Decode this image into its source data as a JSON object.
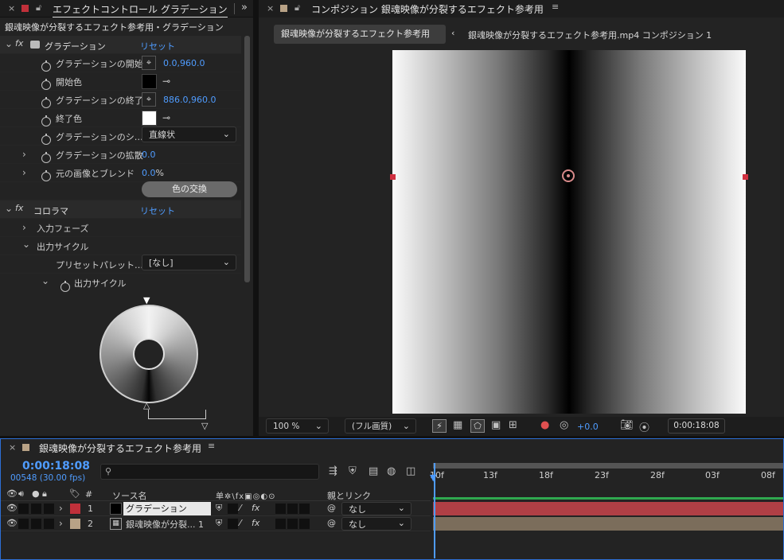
{
  "effects_panel": {
    "tab_title": "エフェクトコントロール グラデーション",
    "layer_path": "銀魂映像が分裂するエフェクト参考用・グラデーション",
    "ramp": {
      "name": "グラデーション",
      "reset": "リセット",
      "start_label": "グラデーションの開始",
      "start_value": "0.0,960.0",
      "start_color_label": "開始色",
      "end_label": "グラデーションの終了",
      "end_value": "886.0,960.0",
      "end_color_label": "終了色",
      "shape_label": "グラデーションのシ…",
      "shape_value": "直線状",
      "scatter_label": "グラデーションの拡散",
      "scatter_value": "0.0",
      "blend_label": "元の画像とブレンド",
      "blend_value": "0.0",
      "blend_unit": "%",
      "swap_button": "色の交換"
    },
    "colorama": {
      "name": "コロラマ",
      "reset": "リセット",
      "input_phase": "入力フェーズ",
      "output_cycle": "出力サイクル",
      "preset_label": "プリセットパレット…",
      "preset_value": "[なし]",
      "output_cycle_prop": "出力サイクル"
    }
  },
  "comp_panel": {
    "tab_title": "コンポジション 銀魂映像が分裂するエフェクト参考用",
    "breadcrumb_active": "銀魂映像が分裂するエフェクト参考用",
    "breadcrumb_next": "銀魂映像が分裂するエフェクト参考用.mp4 コンポジション 1",
    "zoom": "100 %",
    "resolution": "(フル画質)",
    "exposure": "+0.0",
    "timecode": "0:00:18:08"
  },
  "timeline": {
    "tab_title": "銀魂映像が分裂するエフェクト参考用",
    "current_time": "0:00:18:08",
    "frame_info": "00548 (30.00 fps)",
    "search_placeholder": "",
    "col_hash": "#",
    "col_source": "ソース名",
    "col_switches": "单✲\\fx▣◎◐⊙",
    "col_parent": "親とリンク",
    "ruler": [
      "10f",
      "13f",
      "18f",
      "23f",
      "28f",
      "03f",
      "08f"
    ],
    "layers": [
      {
        "num": "1",
        "name": "グラデーション",
        "parent": "なし",
        "label_color": "#c0303a",
        "bar_color": "#b03f45"
      },
      {
        "num": "2",
        "name": "銀魂映像が分裂... 1",
        "parent": "なし",
        "label_color": "#b8a286",
        "bar_color": "#7b6d5b"
      }
    ]
  },
  "colors": {
    "accent_blue": "#4f9cff",
    "panel_bg": "#232323",
    "red_label": "#c0303a"
  }
}
